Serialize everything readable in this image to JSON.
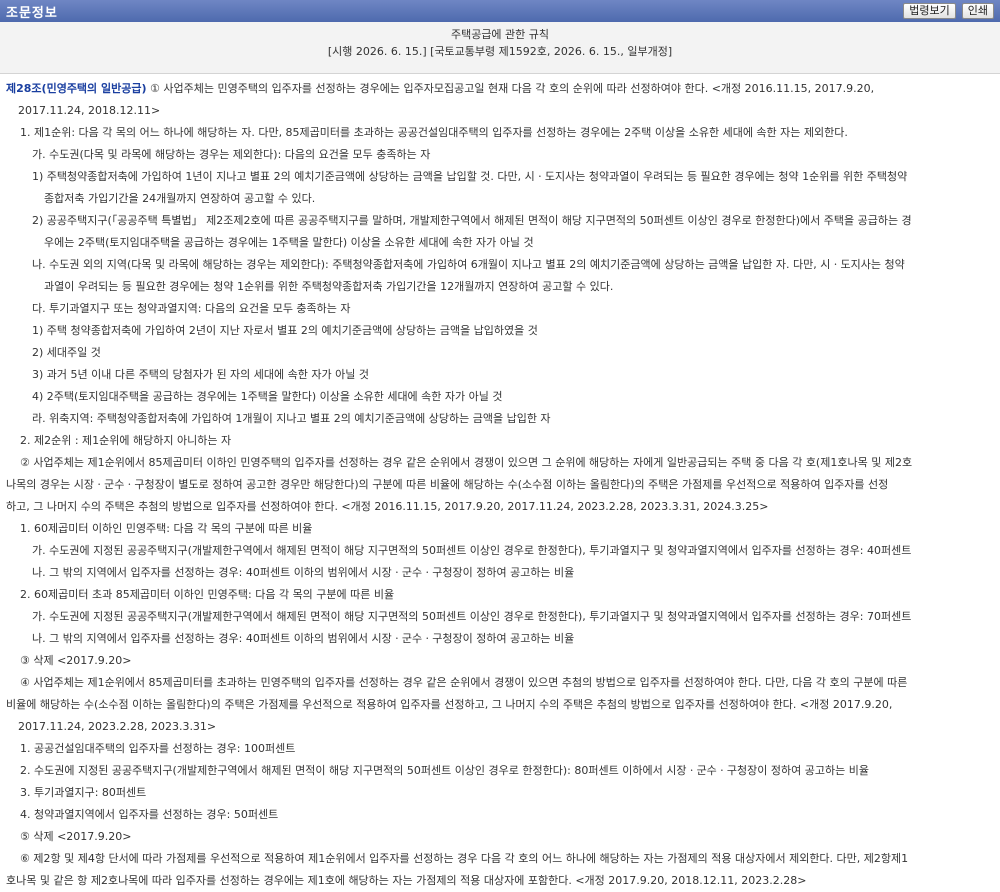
{
  "topbar": {
    "title": "조문정보",
    "btn_law": "법령보기",
    "btn_print": "인쇄"
  },
  "law": {
    "name": "주택공급에 관한 규칙",
    "meta": "[시행 2026. 6. 15.] [국토교통부령 제1592호, 2026. 6. 15., 일부개정]"
  },
  "article": {
    "title": "제28조(민영주택의 일반공급)",
    "lines": [
      "① 사업주체는 민영주택의 입주자를 선정하는 경우에는 입주자모집공고일 현재 다음 각 호의 순위에 따라 선정하여야 한다. <개정 2016.11.15, 2017.9.20,",
      "2017.11.24, 2018.12.11>",
      "1. 제1순위: 다음 각 목의 어느 하나에 해당하는 자. 다만, 85제곱미터를 초과하는 공공건설임대주택의 입주자를 선정하는 경우에는 2주택 이상을 소유한 세대에 속한 자는 제외한다.",
      "가. 수도권(다목 및 라목에 해당하는 경우는 제외한다): 다음의 요건을 모두 충족하는 자",
      "1) 주택청약종합저축에 가입하여 1년이 지나고 별표 2의 예치기준금액에 상당하는 금액을 납입할 것. 다만, 시ㆍ도지사는 청약과열이 우려되는 등 필요한 경우에는 청약 1순위를 위한 주택청약",
      "종합저축 가입기간을 24개월까지 연장하여 공고할 수 있다.",
      "2) 공공주택지구(「공공주택 특별법」 제2조제2호에 따른 공공주택지구를 말하며, 개발제한구역에서 해제된 면적이 해당 지구면적의 50퍼센트 이상인 경우로 한정한다)에서 주택을 공급하는 경",
      "우에는 2주택(토지임대주택을 공급하는 경우에는 1주택을 말한다) 이상을 소유한 세대에 속한 자가 아닐 것",
      "나. 수도권 외의 지역(다목 및 라목에 해당하는 경우는 제외한다): 주택청약종합저축에 가입하여 6개월이 지나고 별표 2의 예치기준금액에 상당하는 금액을 납입한 자. 다만, 시ㆍ도지사는 청약",
      "과열이 우려되는 등 필요한 경우에는 청약 1순위를 위한 주택청약종합저축 가입기간을 12개월까지 연장하여 공고할 수 있다.",
      "다. 투기과열지구 또는 청약과열지역: 다음의 요건을 모두 충족하는 자",
      "1) 주택 청약종합저축에 가입하여 2년이 지난 자로서 별표 2의 예치기준금액에 상당하는 금액을 납입하였을 것",
      "2) 세대주일 것",
      "3) 과거 5년 이내 다른 주택의 당첨자가 된 자의 세대에 속한 자가 아닐 것",
      "4) 2주택(토지임대주택을 공급하는 경우에는 1주택을 말한다) 이상을 소유한 세대에 속한 자가 아닐 것",
      "라. 위축지역: 주택청약종합저축에 가입하여 1개월이 지나고 별표 2의 예치기준금액에 상당하는 금액을 납입한 자",
      "2. 제2순위 : 제1순위에 해당하지 아니하는 자",
      "② 사업주체는 제1순위에서 85제곱미터 이하인 민영주택의 입주자를 선정하는 경우 같은 순위에서 경쟁이 있으면 그 순위에 해당하는 자에게 일반공급되는 주택 중 다음 각 호(제1호나목 및 제2호",
      "나목의 경우는 시장ㆍ군수ㆍ구청장이 별도로 정하여 공고한 경우만 해당한다)의 구분에 따른 비율에 해당하는 수(소수점 이하는 올림한다)의 주택은 가점제를 우선적으로 적용하여 입주자를 선정",
      "하고, 그 나머지 수의 주택은 추첨의 방법으로 입주자를 선정하여야 한다. <개정 2016.11.15, 2017.9.20, 2017.11.24, 2023.2.28, 2023.3.31, 2024.3.25>",
      "1. 60제곱미터 이하인 민영주택: 다음 각 목의 구분에 따른 비율",
      "가. 수도권에 지정된 공공주택지구(개발제한구역에서 해제된 면적이 해당 지구면적의 50퍼센트 이상인 경우로 한정한다), 투기과열지구 및 청약과열지역에서 입주자를 선정하는 경우: 40퍼센트",
      "나. 그 밖의 지역에서 입주자를 선정하는 경우: 40퍼센트 이하의 범위에서 시장ㆍ군수ㆍ구청장이 정하여 공고하는 비율",
      "2. 60제곱미터 초과 85제곱미터 이하인 민영주택: 다음 각 목의 구분에 따른 비율",
      "가. 수도권에 지정된 공공주택지구(개발제한구역에서 해제된 면적이 해당 지구면적의 50퍼센트 이상인 경우로 한정한다), 투기과열지구 및 청약과열지역에서 입주자를 선정하는 경우: 70퍼센트",
      "나. 그 밖의 지역에서 입주자를 선정하는 경우: 40퍼센트 이하의 범위에서 시장ㆍ군수ㆍ구청장이 정하여 공고하는 비율",
      "③ 삭제 <2017.9.20>",
      "④ 사업주체는 제1순위에서 85제곱미터를 초과하는 민영주택의 입주자를 선정하는 경우 같은 순위에서 경쟁이 있으면 추첨의 방법으로 입주자를 선정하여야 한다. 다만, 다음 각 호의 구분에 따른",
      "비율에 해당하는 수(소수점 이하는 올림한다)의 주택은 가점제를 우선적으로 적용하여 입주자를 선정하고, 그 나머지 수의 주택은 추첨의 방법으로 입주자를 선정하여야 한다. <개정 2017.9.20,",
      "2017.11.24, 2023.2.28, 2023.3.31>",
      "1. 공공건설임대주택의 입주자를 선정하는 경우: 100퍼센트",
      "2. 수도권에 지정된 공공주택지구(개발제한구역에서 해제된 면적이 해당 지구면적의 50퍼센트 이상인 경우로 한정한다): 80퍼센트 이하에서 시장ㆍ군수ㆍ구청장이 정하여 공고하는 비율",
      "3. 투기과열지구: 80퍼센트",
      "4. 청약과열지역에서 입주자를 선정하는 경우: 50퍼센트",
      "⑤ 삭제 <2017.9.20>",
      "⑥ 제2항 및 제4항 단서에 따라 가점제를 우선적으로 적용하여 제1순위에서 입주자를 선정하는 경우 다음 각 호의 어느 하나에 해당하는 자는 가점제의 적용 대상자에서 제외한다. 다만, 제2항제1",
      "호나목 및 같은 항 제2호나목에 따라 입주자를 선정하는 경우에는 제1호에 해당하는 자는 가점제의 적용 대상자에 포함한다. <개정 2017.9.20, 2018.12.11, 2023.2.28>"
    ]
  }
}
